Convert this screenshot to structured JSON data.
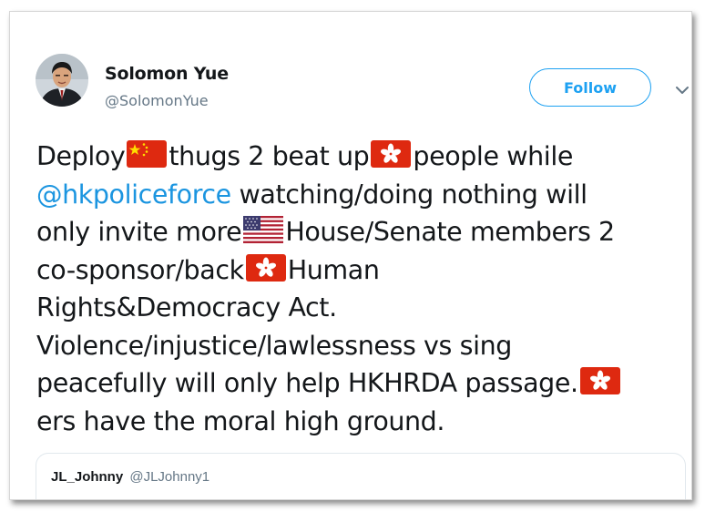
{
  "author": {
    "display_name": "Solomon Yue",
    "handle": "@SolomonYue",
    "avatar_icon": "profile-photo"
  },
  "follow_button": {
    "label": "Follow",
    "color": "#1da1f2"
  },
  "more_menu": {
    "icon": "chevron-down-icon"
  },
  "tweet": {
    "lines": [
      {
        "segments": [
          {
            "type": "text",
            "value": "Deploy"
          },
          {
            "type": "flag",
            "value": "china-flag-emoji"
          },
          {
            "type": "text",
            "value": "thugs 2 beat up"
          },
          {
            "type": "flag",
            "value": "hong-kong-flag-emoji"
          },
          {
            "type": "text",
            "value": "people while"
          }
        ]
      },
      {
        "segments": [
          {
            "type": "mention",
            "value": "@hkpoliceforce"
          },
          {
            "type": "text",
            "value": " watching/doing nothing will"
          }
        ]
      },
      {
        "segments": [
          {
            "type": "text",
            "value": "only invite more"
          },
          {
            "type": "flag",
            "value": "us-flag-emoji"
          },
          {
            "type": "text",
            "value": "House/Senate members 2"
          }
        ]
      },
      {
        "segments": [
          {
            "type": "text",
            "value": "co-sponsor/back"
          },
          {
            "type": "flag",
            "value": "hong-kong-flag-emoji"
          },
          {
            "type": "text",
            "value": "Human"
          }
        ]
      },
      {
        "segments": [
          {
            "type": "text",
            "value": "Rights&Democracy Act."
          }
        ]
      },
      {
        "segments": [
          {
            "type": "text",
            "value": "Violence/injustice/lawlessness vs sing"
          }
        ]
      },
      {
        "segments": [
          {
            "type": "text",
            "value": "peacefully will only help HKHRDA passage."
          },
          {
            "type": "flag",
            "value": "hong-kong-flag-emoji"
          }
        ]
      },
      {
        "segments": [
          {
            "type": "text",
            "value": "ers have the moral high ground."
          }
        ]
      }
    ],
    "text_color": "#14171a",
    "mention_color": "#1b95e0"
  },
  "quoted_tweet": {
    "display_name": "JL_Johnny",
    "handle": "@JLJohnny1"
  }
}
